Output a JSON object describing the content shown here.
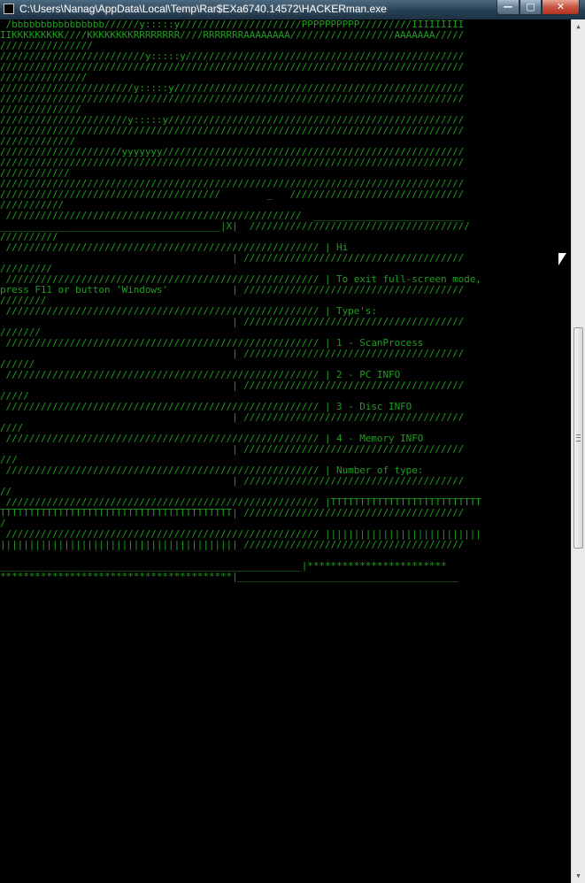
{
  "window": {
    "title": "C:\\Users\\Nanag\\AppData\\Local\\Temp\\Rar$EXa6740.14572\\HACKERman.exe",
    "buttons": {
      "minimize": "—",
      "maximize": "▢",
      "close": "✕"
    }
  },
  "console": {
    "lines": [
      " /bbbbbbbbbbbbbbbb//////y:::::y/////////////////////PPPPPPPPPP/////////IIIIIIIII",
      "IIKKKKKKKKK////KKKKKKKKRRRRRRRR////RRRRRRRAAAAAAAA//////////////////AAAAAAA/////",
      "////////////////",
      "/////////////////////////y:::::y////////////////////////////////////////////////",
      "////////////////////////////////////////////////////////////////////////////////",
      "///////////////",
      "///////////////////////y:::::y//////////////////////////////////////////////////",
      "////////////////////////////////////////////////////////////////////////////////",
      "//////////////",
      "//////////////////////y:::::y///////////////////////////////////////////////////",
      "////////////////////////////////////////////////////////////////////////////////",
      "/////////////",
      "/////////////////////yyyyyyy////////////////////////////////////////////////////",
      "////////////////////////////////////////////////////////////////////////////////",
      "////////////",
      "////////////////////////////////////////////////////////////////////////////////",
      "//////////////////////////////////////        _   //////////////////////////////",
      "///////////",
      " ///////////////////////////////////////////////////  __________________________",
      "______________________________________|X|  //////////////////////////////////////",
      "//////////",
      " ////////////////////////////////////////////////////// | Hi",
      "                                        | //////////////////////////////////////",
      "/////////",
      " ////////////////////////////////////////////////////// | To exit full-screen mode,",
      "press F11 or button 'Windows'           | //////////////////////////////////////",
      "////////",
      " ////////////////////////////////////////////////////// | Type's:",
      "                                        | //////////////////////////////////////",
      "///////",
      " ////////////////////////////////////////////////////// | 1 - ScanProcess",
      "                                        | //////////////////////////////////////",
      "//////",
      " ////////////////////////////////////////////////////// | 2 - PC INFO",
      "                                        | //////////////////////////////////////",
      "/////",
      " ////////////////////////////////////////////////////// | 3 - Disc INFO",
      "                                        | //////////////////////////////////////",
      "////",
      " ////////////////////////////////////////////////////// | 4 - Memory INFO",
      "                                        | //////////////////////////////////////",
      "///",
      " ////////////////////////////////////////////////////// | Number of type:",
      "                                        | //////////////////////////////////////",
      "//",
      " ////////////////////////////////////////////////////// |TTTTTTTTTTTTTTTTTTTTTTTTTT",
      "TTTTTTTTTTTTTTTTTTTTTTTTTTTTTTTTTTTTTTTT| //////////////////////////////////////",
      "/",
      " ////////////////////////////////////////////////////// |||||||||||||||||||||||||||",
      "||||||||||||||||||||||||||||||||||||||||| //////////////////////////////////////",
      "",
      "____________________________________________________|************************",
      "****************************************|______________________________________"
    ]
  }
}
